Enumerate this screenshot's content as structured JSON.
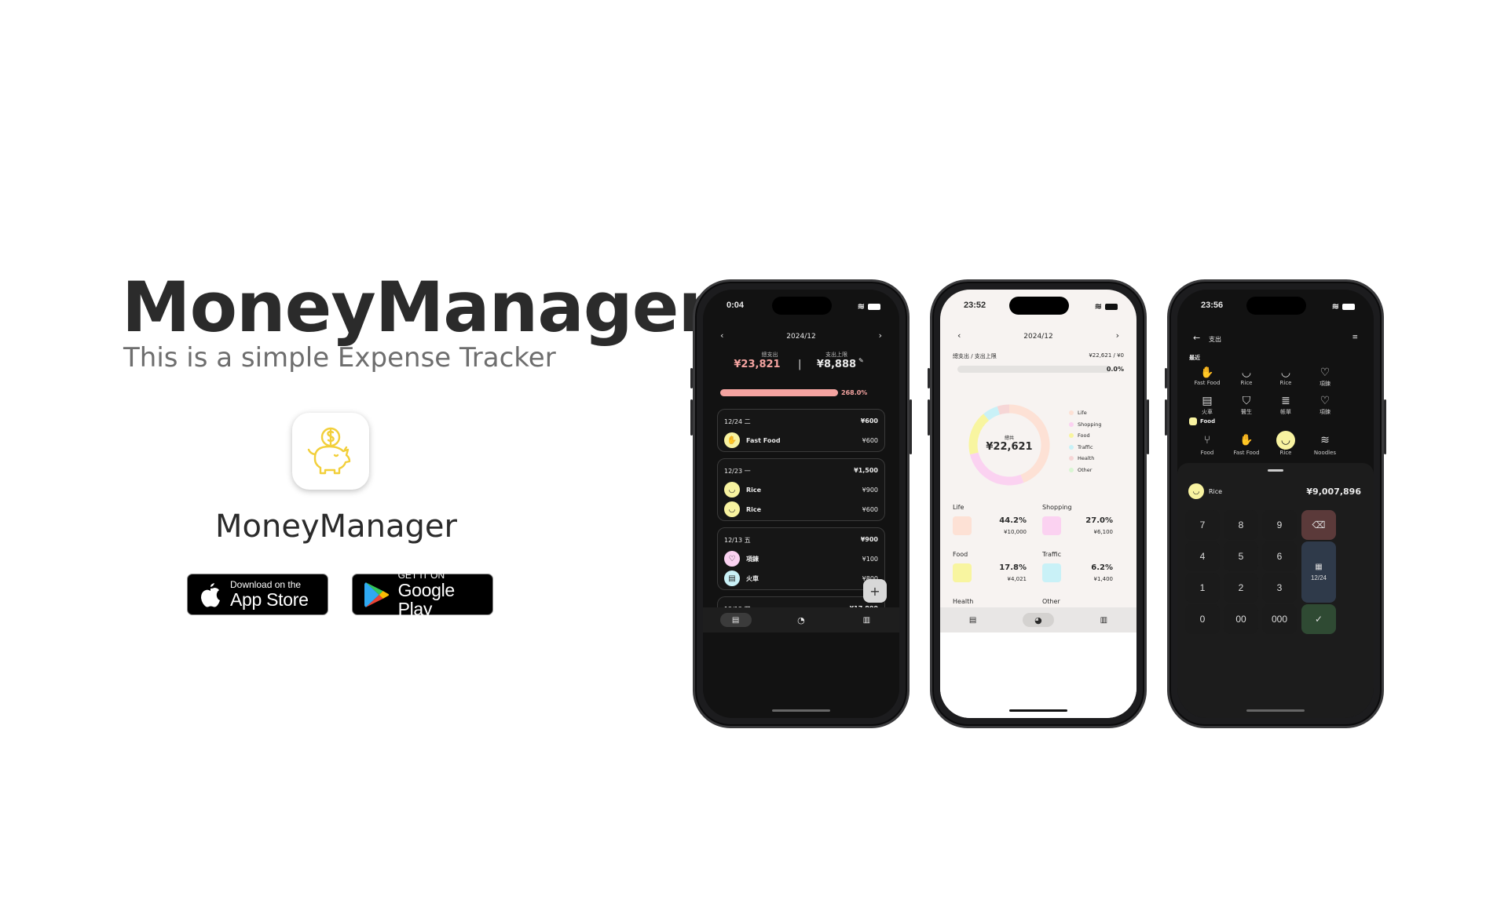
{
  "hero": {
    "title": "MoneyManager",
    "subtitle": "This is a simple Expense Tracker",
    "app_name": "MoneyManager",
    "appstore": {
      "small": "Download on the",
      "big": "App Store"
    },
    "googleplay": {
      "small": "GET IT ON",
      "big": "Google Play"
    }
  },
  "phone1": {
    "time": "0:04",
    "month": "2024/12",
    "total_label": "總支出",
    "total_value": "¥23,821",
    "limit_label": "支出上限",
    "limit_value": "¥8,888",
    "progress_text": "268.0%",
    "progress": 1.0,
    "days": [
      {
        "date": "12/24 二",
        "total": "¥600",
        "items": [
          {
            "name": "Fast   Food",
            "amount": "¥600",
            "color": "#f8f3a0",
            "icon": "fries-icon"
          }
        ]
      },
      {
        "date": "12/23 一",
        "total": "¥1,500",
        "items": [
          {
            "name": "Rice",
            "amount": "¥900",
            "color": "#f8f3a0",
            "icon": "rice-bowl-icon"
          },
          {
            "name": "Rice",
            "amount": "¥600",
            "color": "#f8f3a0",
            "icon": "rice-bowl-icon"
          }
        ]
      },
      {
        "date": "12/13 五",
        "total": "¥900",
        "items": [
          {
            "name": "項鍊",
            "amount": "¥100",
            "color": "#fbd2f1",
            "icon": "necklace-icon"
          },
          {
            "name": "火車",
            "amount": "¥800",
            "color": "#c9f1f7",
            "icon": "train-icon"
          }
        ]
      },
      {
        "date": "12/12 四",
        "total": "¥17,800",
        "items": []
      }
    ],
    "fab": "+"
  },
  "phone2": {
    "time": "23:52",
    "month": "2024/12",
    "summary_label": "總支出 / 支出上限",
    "summary_value": "¥22,621 / ¥0",
    "progress_text": "0.0%",
    "donut_label": "總共",
    "donut_value": "¥22,621",
    "legend": [
      {
        "name": "Life",
        "color": "#fde1d5"
      },
      {
        "name": "Shopping",
        "color": "#fbd2f1"
      },
      {
        "name": "Food",
        "color": "#f8f5a0"
      },
      {
        "name": "Traffic",
        "color": "#c9f1f7"
      },
      {
        "name": "Health",
        "color": "#f6d6d6"
      },
      {
        "name": "Other",
        "color": "#d9f5d3"
      }
    ],
    "stats": [
      {
        "name": "Life",
        "percent": "44.2%",
        "amount": "¥10,000",
        "color": "#fde1d5",
        "share": 0.442
      },
      {
        "name": "Shopping",
        "percent": "27.0%",
        "amount": "¥6,100",
        "color": "#fbd2f1",
        "share": 0.27
      },
      {
        "name": "Food",
        "percent": "17.8%",
        "amount": "¥4,021",
        "color": "#f8f5a0",
        "share": 0.178
      },
      {
        "name": "Traffic",
        "percent": "6.2%",
        "amount": "¥1,400",
        "color": "#c9f1f7",
        "share": 0.062
      },
      {
        "name": "Health",
        "share": 0.048,
        "color": "#f6d6d6"
      },
      {
        "name": "Other",
        "color": "#d9f5d3"
      }
    ]
  },
  "phone3": {
    "time": "23:56",
    "title": "支出",
    "recent_label": "最近",
    "recent": [
      {
        "label": "Fast   Food",
        "icon": "fries-icon",
        "glyph": "✋"
      },
      {
        "label": "Rice",
        "icon": "rice-bowl-icon",
        "glyph": "◡"
      },
      {
        "label": "Rice",
        "icon": "rice-bowl-icon",
        "glyph": "◡"
      },
      {
        "label": "項鍊",
        "icon": "necklace-icon",
        "glyph": "♡"
      },
      {
        "label": "火車",
        "icon": "train-icon",
        "glyph": "▤"
      },
      {
        "label": "醫生",
        "icon": "shield-icon",
        "glyph": "⛉"
      },
      {
        "label": "帳單",
        "icon": "bill-icon",
        "glyph": "≣"
      },
      {
        "label": "項鍊",
        "icon": "necklace-icon",
        "glyph": "♡"
      }
    ],
    "food_label": "Food",
    "food_items": [
      {
        "label": "Food",
        "icon": "cutlery-icon",
        "glyph": "⑂"
      },
      {
        "label": "Fast   Food",
        "icon": "fries-icon",
        "glyph": "✋"
      },
      {
        "label": "Rice",
        "icon": "rice-bowl-icon",
        "glyph": "◡",
        "selected": true
      },
      {
        "label": "Noodles",
        "icon": "noodles-icon",
        "glyph": "≋"
      }
    ],
    "selected_name": "Rice",
    "amount": "¥9,007,896",
    "keys": [
      "7",
      "8",
      "9",
      "4",
      "5",
      "6",
      "1",
      "2",
      "3",
      "0",
      "00",
      "000"
    ],
    "date": "12/24"
  }
}
